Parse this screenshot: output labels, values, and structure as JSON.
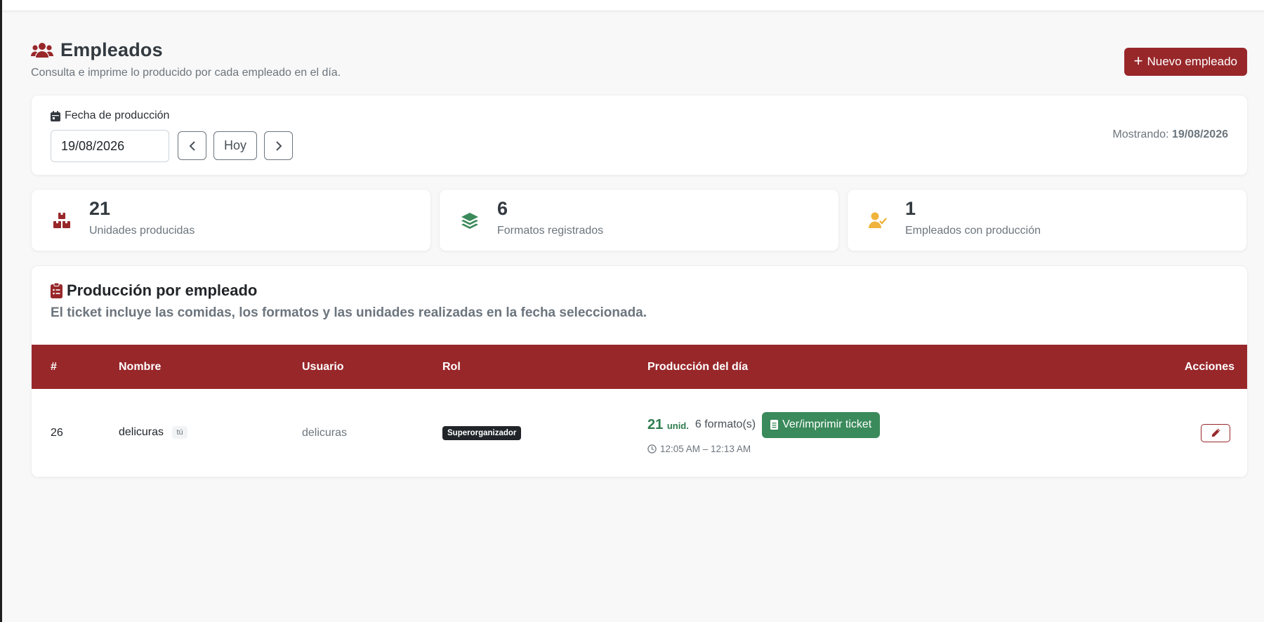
{
  "page": {
    "title": "Empleados",
    "subtitle": "Consulta e imprime lo producido por cada empleado en el día.",
    "new_button": "Nuevo empleado"
  },
  "date_filter": {
    "label": "Fecha de producción",
    "value": "19/08/2026",
    "today_label": "Hoy",
    "showing_prefix": "Mostrando:",
    "showing_value": "19/08/2026"
  },
  "stats": [
    {
      "value": "21",
      "label": "Unidades producidas",
      "icon": "boxes-icon",
      "color": "#98272a"
    },
    {
      "value": "6",
      "label": "Formatos registrados",
      "icon": "layers-icon",
      "color": "#3a8a5b"
    },
    {
      "value": "1",
      "label": "Empleados con producción",
      "icon": "user-check-icon",
      "color": "#f0b43c"
    }
  ],
  "production": {
    "title": "Producción por empleado",
    "subtitle": "El ticket incluye las comidas, los formatos y las unidades realizadas en la fecha seleccionada.",
    "columns": [
      "#",
      "Nombre",
      "Usuario",
      "Rol",
      "Producción del día",
      "Acciones"
    ],
    "rows": [
      {
        "id": "26",
        "name": "delicuras",
        "you_badge": "tú",
        "user": "delicuras",
        "role": "Superorganizador",
        "units": "21",
        "units_suffix": "unid.",
        "formats": "6 formato(s)",
        "ticket_button": "Ver/imprimir ticket",
        "time_range": "12:05 AM – 12:13 AM"
      }
    ]
  },
  "colors": {
    "brand": "#98272a",
    "success": "#3a8a5b",
    "warning": "#f0b43c"
  }
}
